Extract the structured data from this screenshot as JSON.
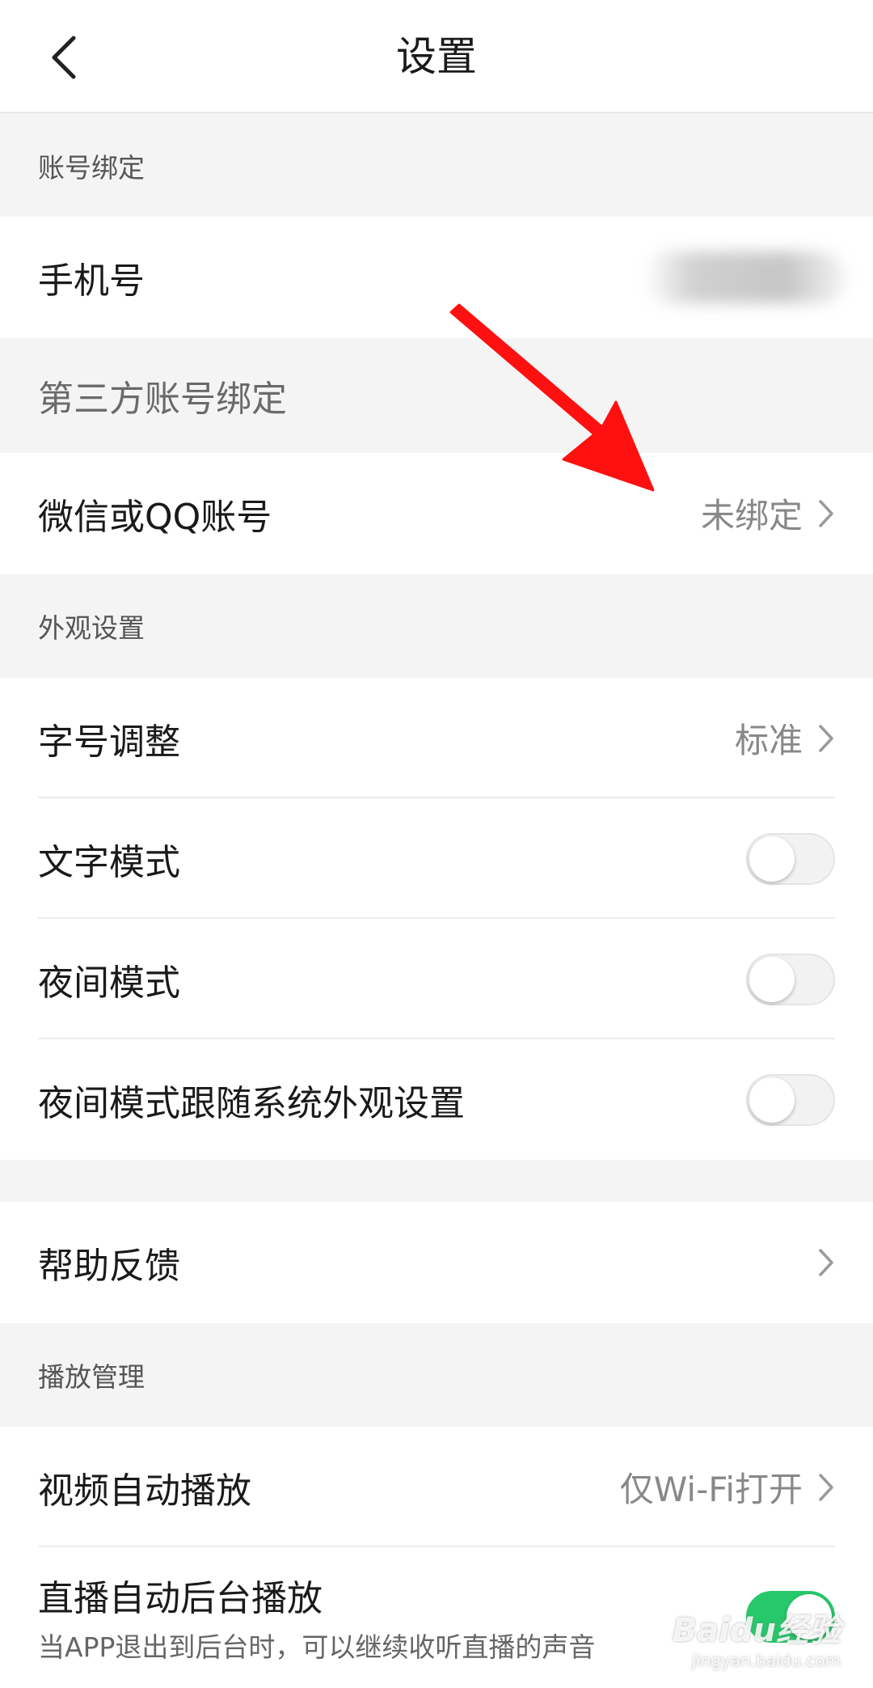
{
  "header": {
    "title": "设置",
    "back_icon": "chevron-left-icon"
  },
  "sections": {
    "account_binding": {
      "title": "账号绑定"
    },
    "third_party": {
      "title": "第三方账号绑定"
    },
    "appearance": {
      "title": "外观设置"
    },
    "playback": {
      "title": "播放管理"
    }
  },
  "rows": {
    "phone": {
      "label": "手机号"
    },
    "wechat_qq": {
      "label": "微信或QQ账号",
      "value": "未绑定"
    },
    "font_size": {
      "label": "字号调整",
      "value": "标准"
    },
    "text_mode": {
      "label": "文字模式",
      "on": false
    },
    "night_mode": {
      "label": "夜间模式",
      "on": false
    },
    "night_follow_system": {
      "label": "夜间模式跟随系统外观设置",
      "on": false
    },
    "help_feedback": {
      "label": "帮助反馈"
    },
    "video_autoplay": {
      "label": "视频自动播放",
      "value": "仅Wi-Fi打开"
    },
    "live_background": {
      "label": "直播自动后台播放",
      "sublabel": "当APP退出到后台时，可以继续收听直播的声音",
      "on": true
    }
  },
  "colors": {
    "toggle_on": "#26c86a",
    "annotation_arrow": "#ff1010",
    "page_background": "#f4f4f4"
  },
  "watermark": {
    "text": "Baidu经验",
    "sub": "jingyan.baidu.com"
  }
}
